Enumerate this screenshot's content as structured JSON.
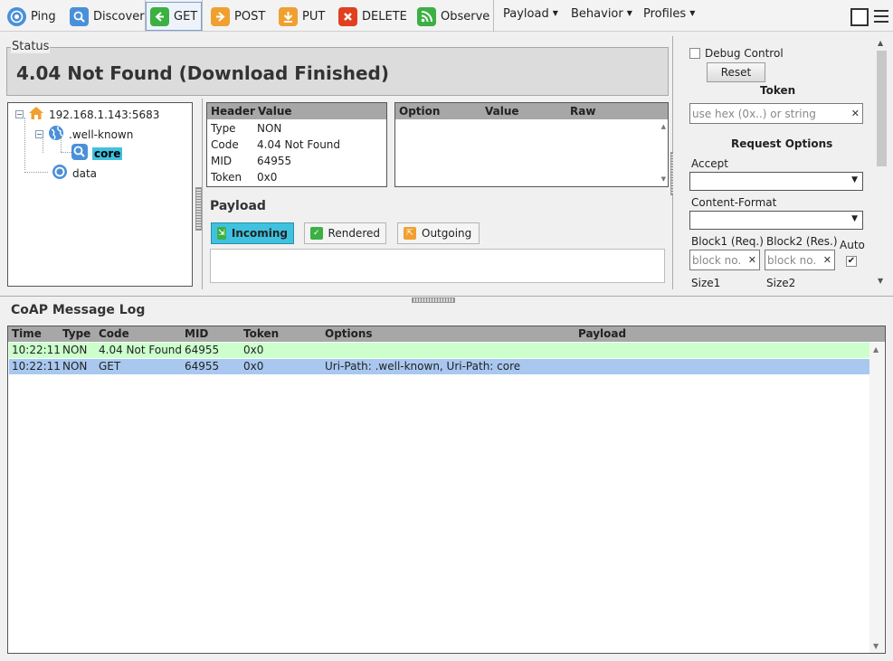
{
  "toolbar": {
    "ping": "Ping",
    "discover": "Discover",
    "get": "GET",
    "post": "POST",
    "put": "PUT",
    "delete": "DELETE",
    "observe": "Observe",
    "menus": {
      "payload": "Payload",
      "behavior": "Behavior",
      "profiles": "Profiles"
    }
  },
  "status": {
    "legend": "Status",
    "text": "4.04 Not Found (Download Finished)"
  },
  "tree": {
    "root": "192.168.1.143:5683",
    "well_known": ".well-known",
    "core": "core",
    "data": "data"
  },
  "header_table": {
    "columns": [
      "Header",
      "Value"
    ],
    "rows": [
      {
        "k": "Type",
        "v": "NON"
      },
      {
        "k": "Code",
        "v": "4.04 Not Found"
      },
      {
        "k": "MID",
        "v": "64955"
      },
      {
        "k": "Token",
        "v": "0x0"
      }
    ]
  },
  "option_table": {
    "columns": [
      "Option",
      "Value",
      "Raw"
    ]
  },
  "payload": {
    "title": "Payload",
    "tabs": [
      "Incoming",
      "Rendered",
      "Outgoing"
    ],
    "active_tab": "Incoming"
  },
  "right_panel": {
    "debug_control": "Debug Control",
    "reset": "Reset",
    "token_title": "Token",
    "token_placeholder": "use hex (0x..) or string",
    "request_options": "Request Options",
    "accept": "Accept",
    "content_format": "Content-Format",
    "block1": "Block1 (Req.)",
    "block2": "Block2 (Res.)",
    "auto": "Auto",
    "block_placeholder": "block no.",
    "size1": "Size1",
    "size2": "Size2"
  },
  "log": {
    "title": "CoAP Message Log",
    "columns": [
      "Time",
      "Type",
      "Code",
      "MID",
      "Token",
      "Options",
      "Payload"
    ],
    "rows": [
      {
        "time": "10:22:11",
        "type": "NON",
        "code": "4.04 Not Found",
        "mid": "64955",
        "token": "0x0",
        "options": "",
        "payload": ""
      },
      {
        "time": "10:22:11",
        "type": "NON",
        "code": "GET",
        "mid": "64955",
        "token": "0x0",
        "options": "Uri-Path: .well-known, Uri-Path: core",
        "payload": ""
      }
    ]
  },
  "colors": {
    "selection": "#3fc2e0",
    "log_response_row": "#ccffcc",
    "log_request_row": "#a8c8f0",
    "ping_icon": "#4a90d9",
    "get_icon": "#3cb043",
    "post_icon": "#f0a030",
    "delete_icon": "#e04020",
    "observe_icon": "#3cb043"
  },
  "icons": {
    "ping": "ping-target-icon",
    "discover": "discover-search-icon",
    "get": "get-arrow-left-icon",
    "post": "post-arrow-right-icon",
    "put": "put-arrow-down-icon",
    "delete": "delete-x-icon",
    "observe": "observe-rss-icon",
    "home": "home-icon",
    "globe": "globe-icon",
    "search": "search-icon",
    "resource": "resource-circle-icon"
  }
}
